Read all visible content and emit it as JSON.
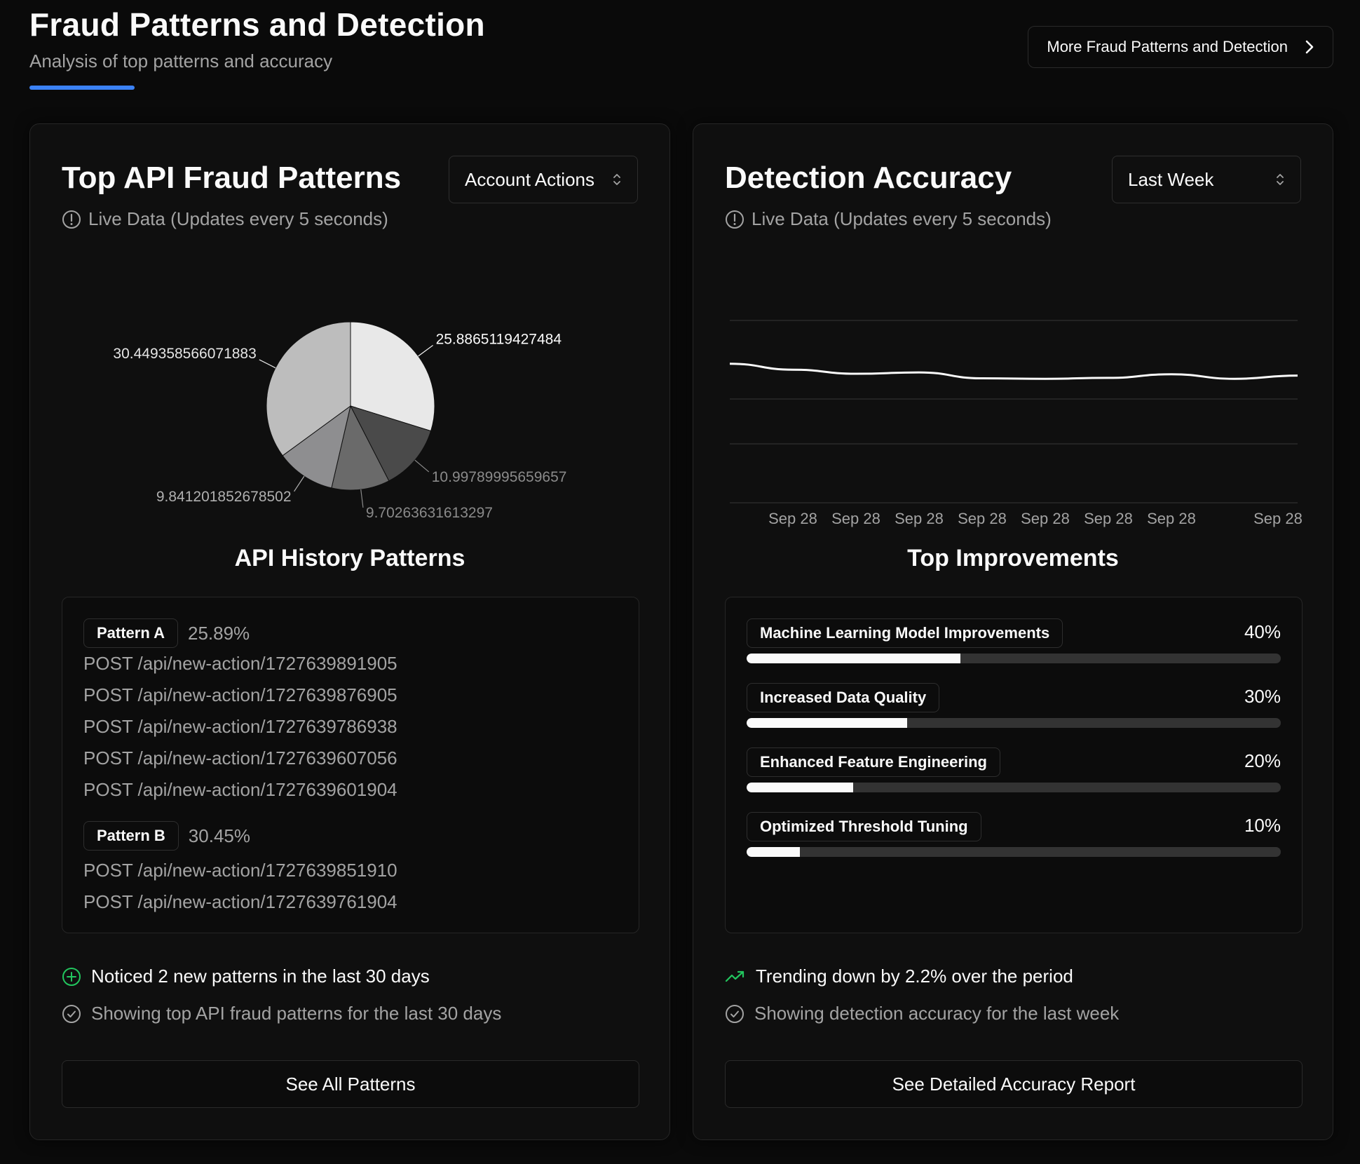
{
  "header": {
    "title": "Fraud Patterns and Detection",
    "subtitle": "Analysis of top patterns and accuracy",
    "more_button_label": "More Fraud Patterns and Detection"
  },
  "left_card": {
    "title": "Top API Fraud Patterns",
    "select_value": "Account Actions",
    "live_label": "Live Data (Updates every 5 seconds)",
    "section_title": "API History Patterns",
    "patterns": [
      {
        "name": "Pattern A",
        "percent": "25.89%",
        "endpoints": [
          "POST /api/new-action/1727639891905",
          "POST /api/new-action/1727639876905",
          "POST /api/new-action/1727639786938",
          "POST /api/new-action/1727639607056",
          "POST /api/new-action/1727639601904"
        ]
      },
      {
        "name": "Pattern B",
        "percent": "30.45%",
        "endpoints": [
          "POST /api/new-action/1727639851910",
          "POST /api/new-action/1727639761904"
        ]
      }
    ],
    "footnote_primary": "Noticed 2 new patterns in the last 30 days",
    "footnote_secondary": "Showing top API fraud patterns for the last 30 days",
    "button_label": "See All Patterns"
  },
  "right_card": {
    "title": "Detection Accuracy",
    "select_value": "Last Week",
    "live_label": "Live Data (Updates every 5 seconds)",
    "section_title": "Top Improvements",
    "improvements": [
      {
        "label": "Machine Learning Model Improvements",
        "percent": "40%",
        "value": 40
      },
      {
        "label": "Increased Data Quality",
        "percent": "30%",
        "value": 30
      },
      {
        "label": "Enhanced Feature Engineering",
        "percent": "20%",
        "value": 20
      },
      {
        "label": "Optimized Threshold Tuning",
        "percent": "10%",
        "value": 10
      }
    ],
    "footnote_primary": "Trending down by 2.2% over the period",
    "footnote_secondary": "Showing detection accuracy for the last week",
    "button_label": "See Detailed Accuracy Report"
  },
  "colors": {
    "accent": "#3b82f6",
    "positive": "#22c55e",
    "background": "#0a0a0a",
    "card": "#0f0f0f",
    "muted_text": "#a3a3a3"
  },
  "chart_data": [
    {
      "type": "pie",
      "values": [
        25.8865119427484,
        10.99789995659657,
        9.70263631613297,
        9.841201852678502,
        30.449358566071883
      ],
      "labels": [
        "25.8865119427484",
        "10.99789995659657",
        "9.70263631613297",
        "9.841201852678502",
        "30.449358566071883"
      ],
      "colors": [
        "#e8e8e8",
        "#4a4a4a",
        "#6a6a6a",
        "#8e8e90",
        "#bdbdbd"
      ],
      "label_colors": [
        "#fafafa",
        "#8a8a8a",
        "#8a8a8a",
        "#b0b0b0",
        "#e5e5e5"
      ],
      "start_angle_deg": -90
    },
    {
      "type": "line",
      "x": [
        "Sep 28",
        "Sep 28",
        "Sep 28",
        "Sep 28",
        "Sep 28",
        "Sep 28",
        "Sep 28",
        "Sep 28",
        "Sep 28",
        "Sep 28"
      ],
      "x_tick_labels": [
        "Sep 28",
        "Sep 28",
        "Sep 28",
        "Sep 28",
        "Sep 28",
        "Sep 28",
        "Sep 28",
        "Sep 28"
      ],
      "values": [
        0.905,
        0.892,
        0.883,
        0.886,
        0.873,
        0.872,
        0.874,
        0.882,
        0.872,
        0.879
      ],
      "ylim": [
        0.6,
        1.0
      ],
      "grid": true,
      "series_color": "#fafafa"
    }
  ]
}
